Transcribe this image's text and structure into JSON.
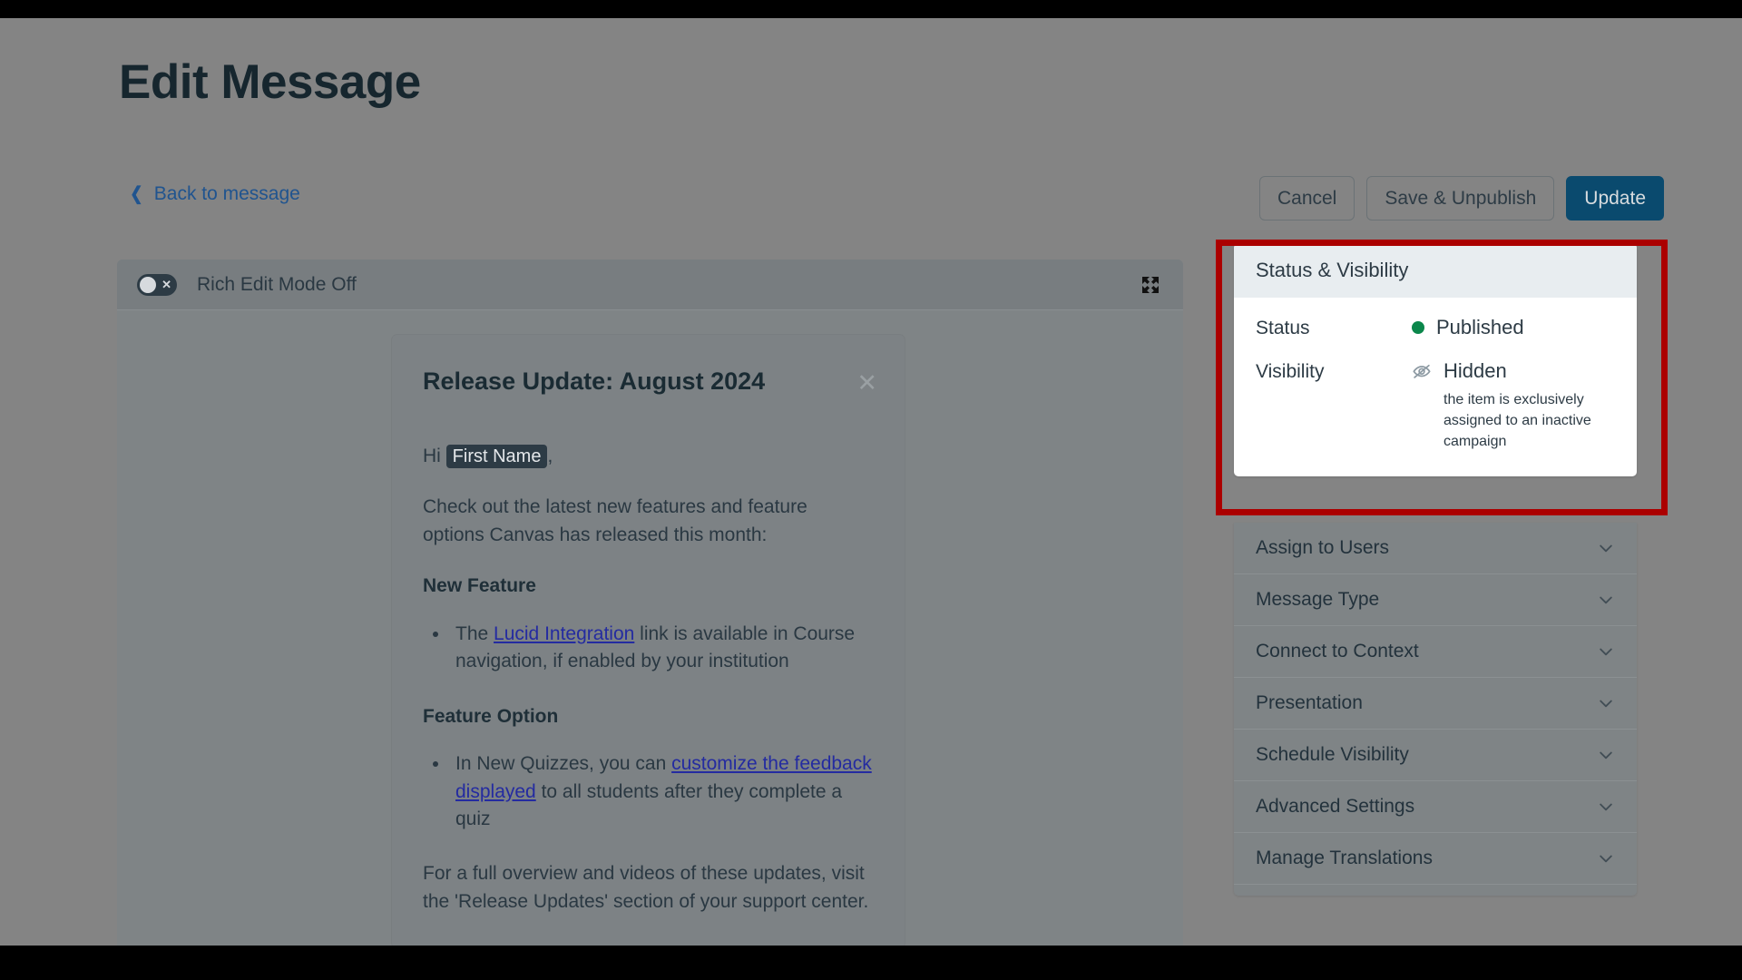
{
  "header": {
    "title": "Edit Message",
    "back_link": "Back to message",
    "back_icon": "chevron-left-icon"
  },
  "actions": {
    "cancel": "Cancel",
    "save_unpublish": "Save & Unpublish",
    "update": "Update",
    "primary_color": "#0a4a6e"
  },
  "editor": {
    "rich_edit_label": "Rich Edit Mode Off",
    "toggle_state": "off",
    "toggle_icon": "toggle-off-icon",
    "expand_icon": "fullscreen-expand-icon"
  },
  "message": {
    "title": "Release Update: August 2024",
    "close_icon": "close-icon",
    "greeting_prefix": "Hi ",
    "greeting_pill": "First Name",
    "greeting_suffix": ",",
    "intro": "Check out the latest new features and feature options Canvas has released this month:",
    "section_1_heading": "New Feature",
    "bullet_1_pre": "The ",
    "bullet_1_link": "Lucid Integration",
    "bullet_1_post": " link is available in Course navigation, if enabled by your institution",
    "section_2_heading": "Feature Option",
    "bullet_2_pre": "In New Quizzes, you can ",
    "bullet_2_link": "customize the feedback displayed",
    "bullet_2_post": " to all students after they complete a quiz",
    "outro": "For a full overview and videos of these updates, visit the 'Release Updates' section of your support center.",
    "link_color": "#242ba0"
  },
  "status_panel": {
    "heading": "Status & Visibility",
    "status_label": "Status",
    "status_value": "Published",
    "status_dot_color": "#0b874b",
    "status_icon": "green-dot-icon",
    "visibility_label": "Visibility",
    "visibility_value": "Hidden",
    "visibility_icon": "eye-slash-icon",
    "visibility_note": "the item is exclusively assigned to an inactive campaign"
  },
  "highlight": {
    "color": "#ab0000"
  },
  "accordion": {
    "items": [
      {
        "label": "Assign to Users",
        "icon": "chevron-down-icon"
      },
      {
        "label": "Message Type",
        "icon": "chevron-down-icon"
      },
      {
        "label": "Connect to Context",
        "icon": "chevron-down-icon"
      },
      {
        "label": "Presentation",
        "icon": "chevron-down-icon"
      },
      {
        "label": "Schedule Visibility",
        "icon": "chevron-down-icon"
      },
      {
        "label": "Advanced Settings",
        "icon": "chevron-down-icon"
      },
      {
        "label": "Manage Translations",
        "icon": "chevron-down-icon"
      }
    ]
  }
}
